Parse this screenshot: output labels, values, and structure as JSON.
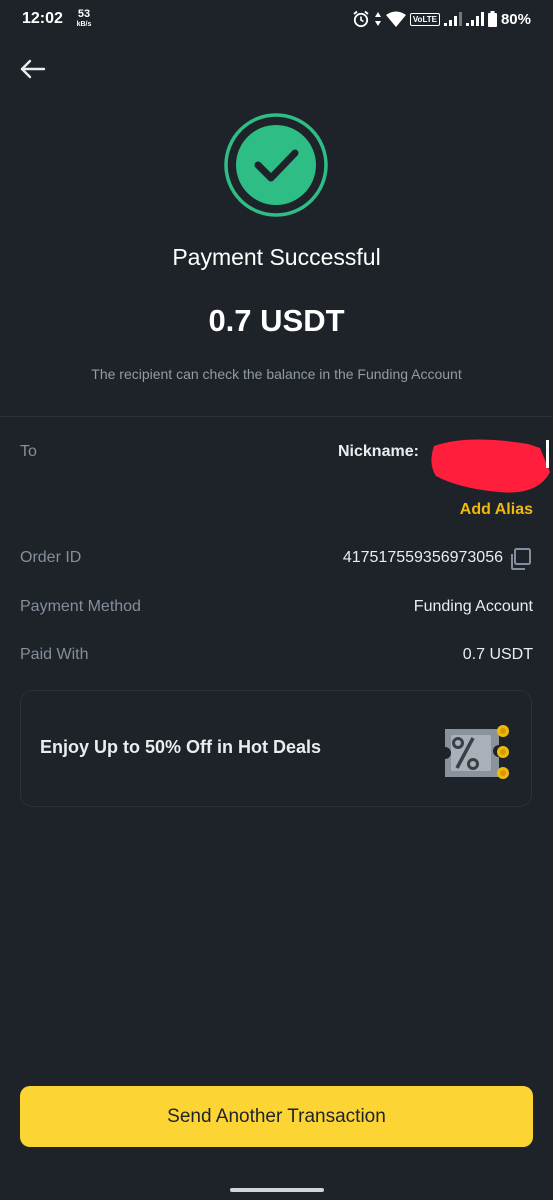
{
  "status_bar": {
    "time": "12:02",
    "net_speed": "53",
    "net_unit": "kB/s",
    "volte": "VoLTE",
    "battery": "80%"
  },
  "icons": {
    "back": "back-arrow-icon",
    "success": "checkmark-circle-icon",
    "copy": "copy-icon",
    "promo": "discount-ticket-icon"
  },
  "header": {
    "title": "Payment Successful",
    "amount": "0.7 USDT",
    "note": "The recipient can check the balance in the Funding Account"
  },
  "details": {
    "to_label": "To",
    "nickname_label": "Nickname:",
    "add_alias": "Add Alias",
    "order_id_label": "Order ID",
    "order_id_value": "417517559356973056",
    "payment_method_label": "Payment Method",
    "payment_method_value": "Funding Account",
    "paid_with_label": "Paid With",
    "paid_with_value": "0.7 USDT"
  },
  "promo": {
    "text": "Enjoy Up to 50% Off in Hot Deals"
  },
  "actions": {
    "send_another": "Send Another Transaction"
  },
  "colors": {
    "background": "#1e2329",
    "accent_yellow": "#fcd535",
    "link_yellow": "#f0b90b",
    "success_green": "#2ebd85",
    "redaction_red": "#ff1f3d"
  }
}
